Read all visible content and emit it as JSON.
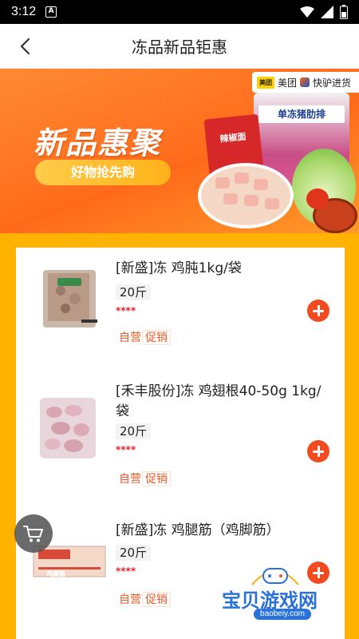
{
  "status_bar": {
    "time": "3:12",
    "badge": "A"
  },
  "header": {
    "title": "冻品新品钜惠"
  },
  "banner": {
    "headline": "新品惠聚",
    "subline": "好物抢先购",
    "brand_meituan": "美团",
    "brand_meituan_logo": "美团",
    "brand_kuailv": "快驴进货",
    "box_label_1": "辣椒面",
    "box_label_2": "单冻猪肋排"
  },
  "products": [
    {
      "title": "[新盛]冻 鸡肫1kg/袋",
      "spec": "20斤",
      "price": "****",
      "tag_self": "自营",
      "tag_promo": "促销",
      "image_icon": "frozen-chicken-gizzard-bag"
    },
    {
      "title": "[禾丰股份]冻 鸡翅根40-50g 1kg/袋",
      "spec": "20斤",
      "price": "****",
      "tag_self": "自营",
      "tag_promo": "促销",
      "image_icon": "frozen-chicken-drumette-bag"
    },
    {
      "title": "[新盛]冻 鸡腿筋（鸡脚筋）",
      "spec": "20斤",
      "price": "****",
      "tag_self": "自营",
      "tag_promo": "促销",
      "image_icon": "chicken-tendon-box",
      "box_text": "鸡腿筋"
    }
  ],
  "watermark": {
    "text": "宝贝游戏网",
    "url": "baobeiy.com"
  },
  "colors": {
    "accent": "#ff6a1a",
    "content_bg": "#ffb200",
    "price": "#e8202a",
    "add_button": "#f44a1f"
  }
}
